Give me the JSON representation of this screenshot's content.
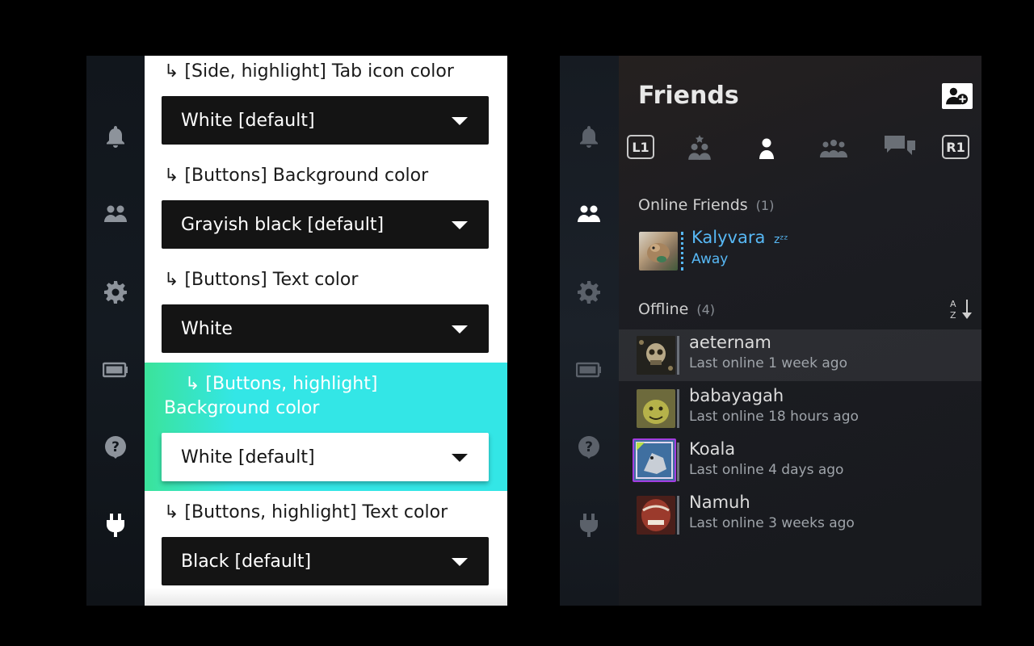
{
  "left_panel": {
    "rail_icons": [
      "bell-icon",
      "friends-icon",
      "gear-icon",
      "battery-icon",
      "help-icon",
      "plug-icon"
    ],
    "options": [
      {
        "label": "↳ [Side, highlight] Tab icon color",
        "value": "White [default]"
      },
      {
        "label": "↳ [Buttons] Background color",
        "value": "Grayish black [default]"
      },
      {
        "label": "↳ [Buttons] Text color",
        "value": "White"
      },
      {
        "label": "↳ [Buttons, highlight] Background color",
        "value": "White [default]"
      },
      {
        "label": "↳ [Buttons, highlight] Text color",
        "value": "Black [default]"
      }
    ],
    "colors": {
      "accent_left": "#3be39a",
      "accent": "#33e6e6",
      "button_bg": "#141414"
    }
  },
  "right_panel": {
    "title": "Friends",
    "tabs": {
      "left_bumper": "L1",
      "right_bumper": "R1"
    },
    "online": {
      "heading": "Online Friends",
      "count": "(1)",
      "friends": [
        {
          "name": "Kalyvara",
          "badge": "zᶻᶻ",
          "status": "Away"
        }
      ]
    },
    "offline": {
      "heading": "Offline",
      "count": "(4)",
      "friends": [
        {
          "name": "aeternam",
          "status": "Last online 1 week ago"
        },
        {
          "name": "babayagah",
          "status": "Last online 18 hours ago"
        },
        {
          "name": "Koala",
          "status": "Last online 4 days ago"
        },
        {
          "name": "Namuh",
          "status": "Last online 3 weeks ago"
        }
      ]
    },
    "colors": {
      "online_name": "#57b8f5",
      "offline_bar": "#6b7078",
      "koala_frame": "#a23de0"
    }
  }
}
